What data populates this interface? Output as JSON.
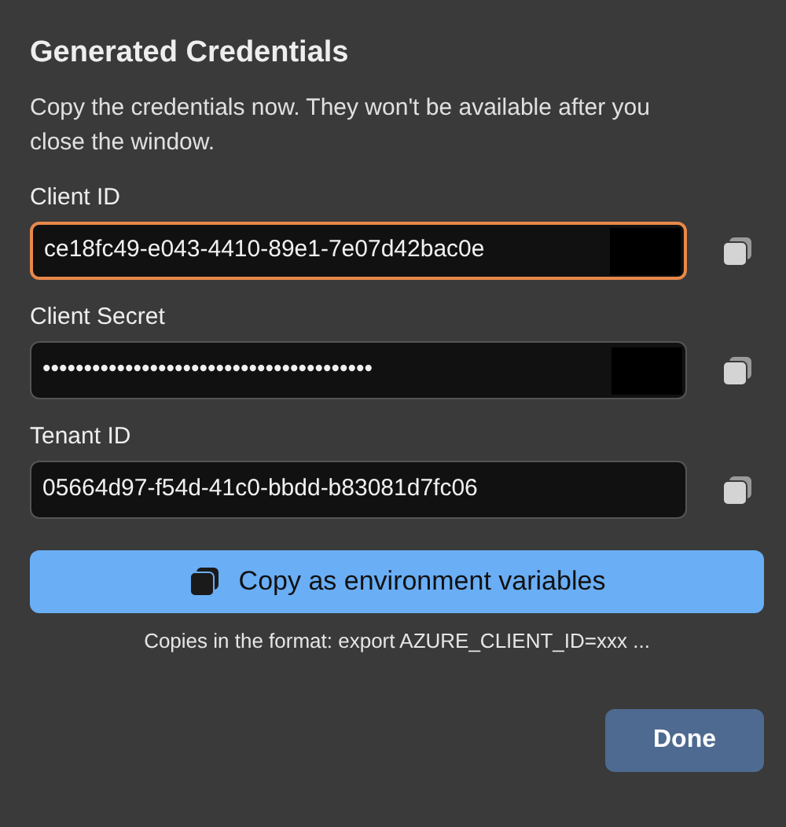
{
  "dialog": {
    "title": "Generated Credentials",
    "description": "Copy the credentials now. They won't be available after you close the window."
  },
  "fields": [
    {
      "label": "Client ID",
      "value": "ce18fc49-e043-4410-89e1-7e07d42bac0e",
      "focused": true,
      "masked_end": true
    },
    {
      "label": "Client Secret",
      "value": "••••••••••••••••••••••••••••••••••••••••",
      "focused": false,
      "masked_end": true
    },
    {
      "label": "Tenant ID",
      "value": "05664d97-f54d-41c0-bbdd-b83081d7fc06",
      "focused": false,
      "masked_end": false
    }
  ],
  "copy_env_button": {
    "label": "Copy as environment variables"
  },
  "format_note": "Copies in the format: export AZURE_CLIENT_ID=xxx ...",
  "done_button": {
    "label": "Done"
  }
}
